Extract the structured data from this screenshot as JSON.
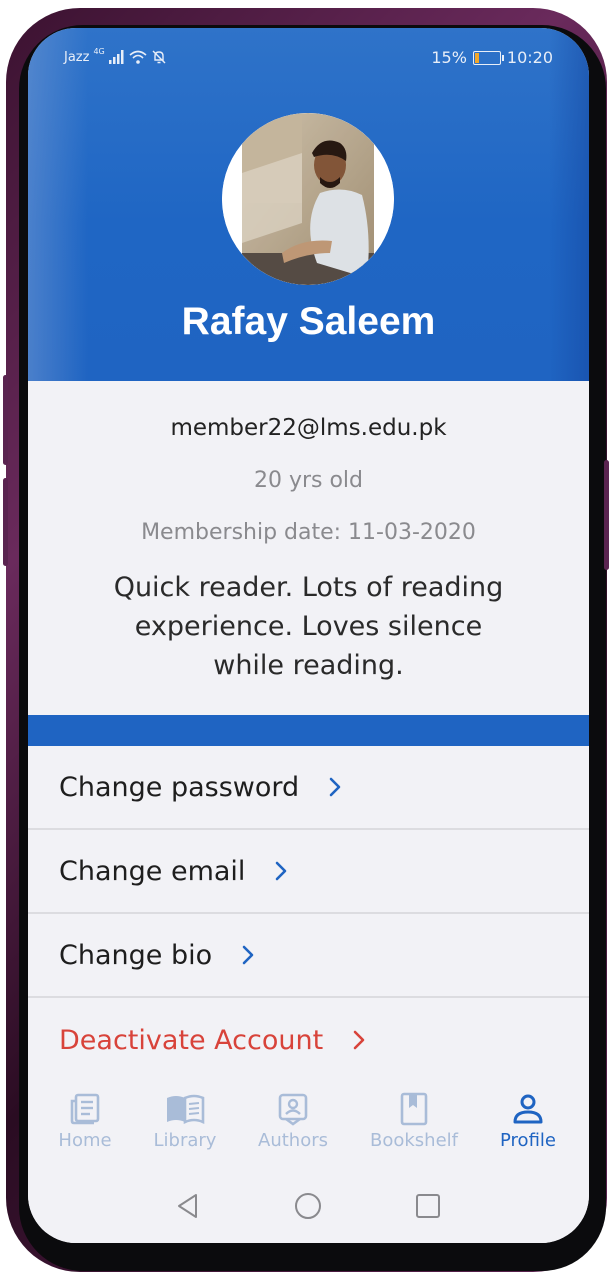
{
  "status_bar": {
    "carrier": "Jazz",
    "network": "4G",
    "battery": "15%",
    "time": "10:20",
    "colors": {
      "battery_fill": "#f2a72a"
    }
  },
  "profile": {
    "name": "Rafay Saleem",
    "email": "member22@lms.edu.pk",
    "age": "20 yrs old",
    "membership_date": "Membership date: 11-03-2020",
    "bio": "Quick reader. Lots of reading experience. Loves silence while reading."
  },
  "menu": {
    "change_password": "Change password",
    "change_email": "Change email",
    "change_bio": "Change bio",
    "deactivate": "Deactivate Account"
  },
  "tabs": [
    {
      "label": "Home",
      "icon": "news-icon",
      "active": false
    },
    {
      "label": "Library",
      "icon": "open-book-icon",
      "active": false
    },
    {
      "label": "Authors",
      "icon": "author-badge-icon",
      "active": false
    },
    {
      "label": "Bookshelf",
      "icon": "bookmark-book-icon",
      "active": false
    },
    {
      "label": "Profile",
      "icon": "person-icon",
      "active": true
    }
  ],
  "colors": {
    "primary": "#1f64c2",
    "danger": "#d8433a",
    "inactive_tab": "#a9bcd8",
    "background": "#f2f2f6"
  }
}
